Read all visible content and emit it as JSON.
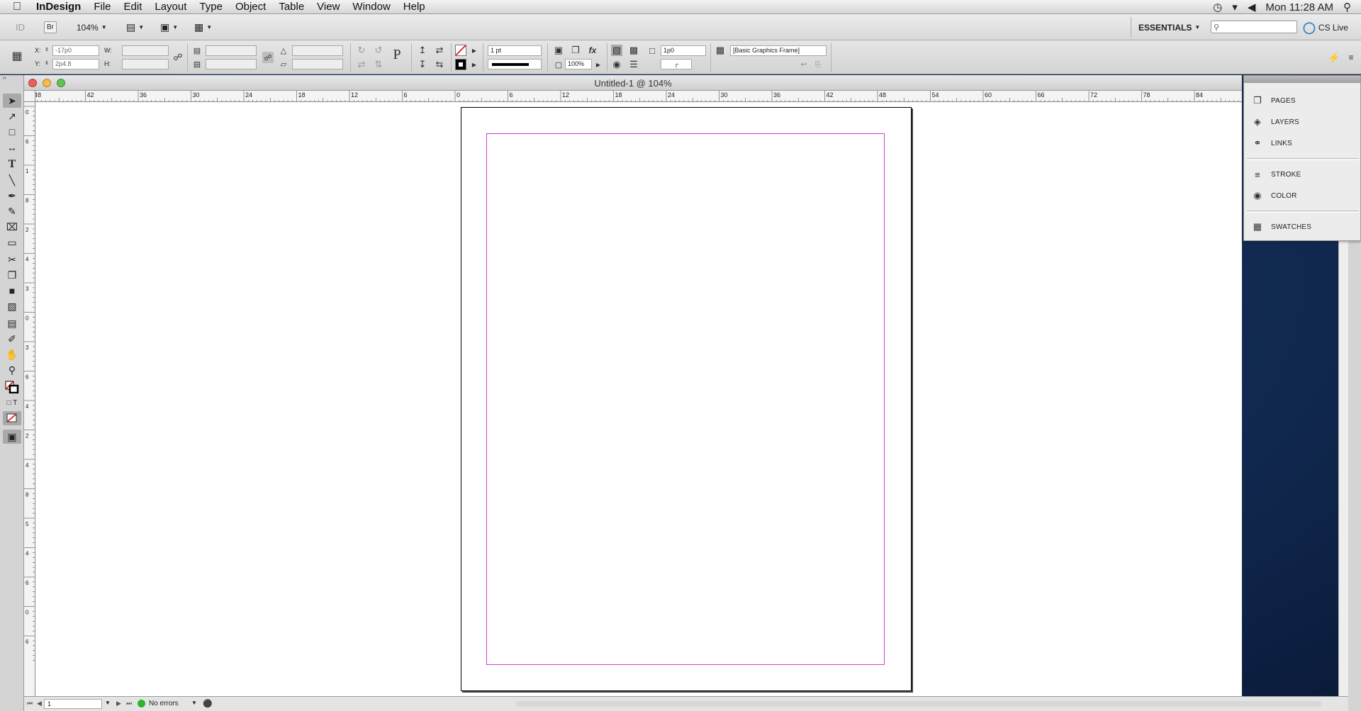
{
  "menubar": {
    "apple_icon": "apple-icon",
    "app_name": "InDesign",
    "items": [
      "File",
      "Edit",
      "Layout",
      "Type",
      "Object",
      "Table",
      "View",
      "Window",
      "Help"
    ],
    "clock": "Mon 11:28 AM"
  },
  "appbar": {
    "id_logo": "ID",
    "br_label": "Br",
    "zoom": "104%",
    "workspace": "ESSENTIALS",
    "search_placeholder": "",
    "cs_live": "CS Live"
  },
  "control": {
    "x_label": "X:",
    "x_value": "-17p0",
    "y_label": "Y:",
    "y_value": "2p4.8",
    "w_label": "W:",
    "w_value": "",
    "h_label": "H:",
    "h_value": "",
    "stroke_weight": "1 pt",
    "opacity": "100%",
    "text_wrap_offset": "1p0",
    "object_style": "[Basic Graphics Frame]"
  },
  "document": {
    "title": "Untitled-1 @ 104%"
  },
  "ruler": {
    "h_labels": [
      "48",
      "42",
      "36",
      "30",
      "24",
      "18",
      "12",
      "6",
      "0",
      "6",
      "12",
      "18",
      "24",
      "30",
      "36",
      "42",
      "48",
      "54",
      "60",
      "66",
      "72",
      "78",
      "84"
    ],
    "v_labels": [
      "0",
      "6",
      "1",
      "8",
      "2",
      "4",
      "3",
      "0",
      "3",
      "6",
      "4",
      "2",
      "4",
      "8",
      "5",
      "4",
      "6",
      "0",
      "6"
    ]
  },
  "panels": {
    "group1": [
      "PAGES",
      "LAYERS",
      "LINKS"
    ],
    "group2": [
      "STROKE",
      "COLOR"
    ],
    "group3": [
      "SWATCHES"
    ]
  },
  "status": {
    "page_number": "1",
    "preflight": "No errors"
  },
  "colors": {
    "margin_guide": "#d040d0",
    "preflight_ok": "#2cb52c"
  }
}
